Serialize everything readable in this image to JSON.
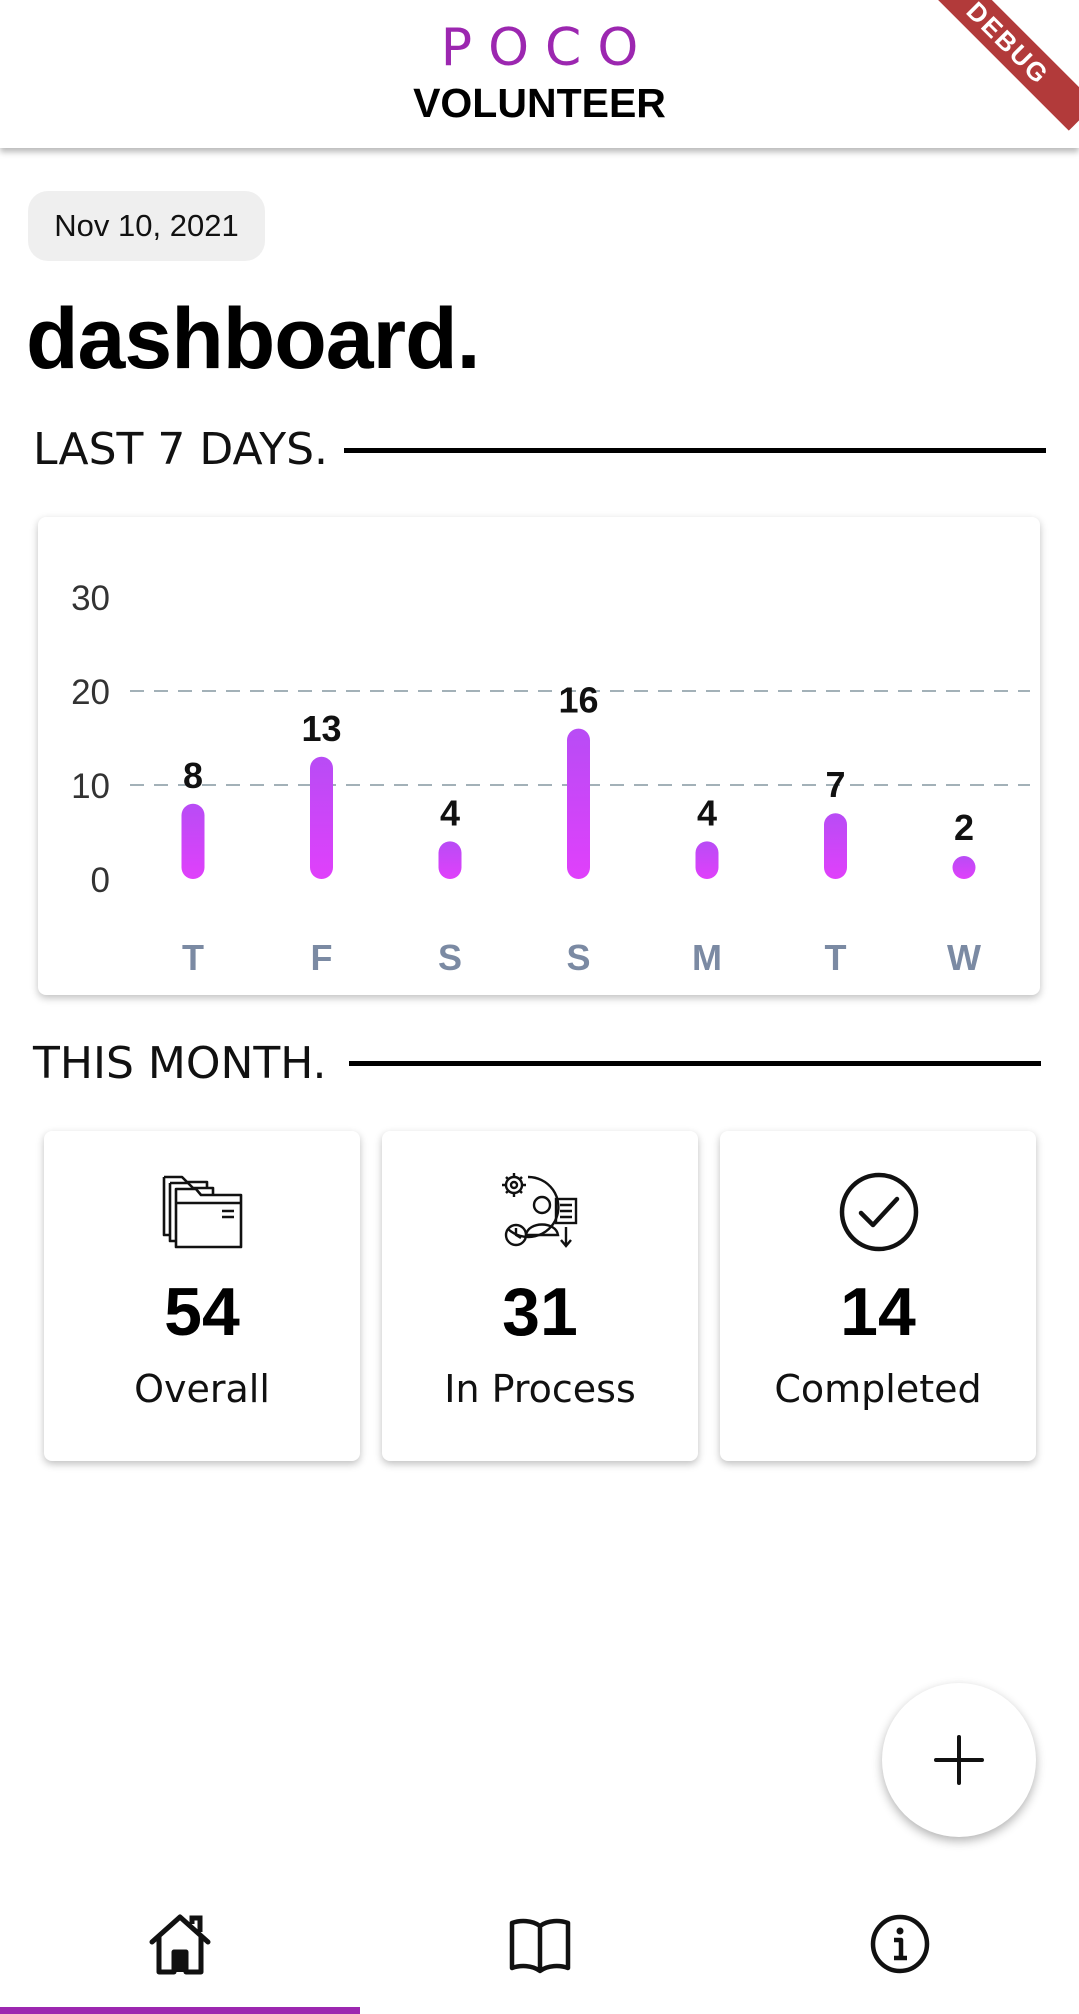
{
  "app": {
    "brand_top": "POCO",
    "brand_bottom": "VOLUNTEER",
    "debug_banner": "DEBUG"
  },
  "header": {
    "date": "Nov 10, 2021",
    "title": "dashboard."
  },
  "sections": {
    "last7": "LAST 7 DAYS.",
    "month": "THIS MONTH."
  },
  "chart_data": {
    "type": "bar",
    "categories": [
      "T",
      "F",
      "S",
      "S",
      "M",
      "T",
      "W"
    ],
    "values": [
      8,
      13,
      4,
      16,
      4,
      7,
      2
    ],
    "yticks": [
      0,
      10,
      20,
      30
    ],
    "ylim": [
      0,
      30
    ],
    "grid": "dashed horizontal at 10 and 20",
    "colors": {
      "bar_top": "#b84cf5",
      "bar_bottom": "#e040fb",
      "tick": "#7b8aa3",
      "grid": "#a3b1b8"
    }
  },
  "stats": [
    {
      "value": "54",
      "label": "Overall",
      "icon": "folders-icon"
    },
    {
      "value": "31",
      "label": "In Process",
      "icon": "process-icon"
    },
    {
      "value": "14",
      "label": "Completed",
      "icon": "check-circle-icon"
    }
  ],
  "fab": {
    "icon": "plus-icon"
  },
  "nav": {
    "items": [
      {
        "icon": "home-icon",
        "active": true
      },
      {
        "icon": "book-icon",
        "active": false
      },
      {
        "icon": "info-icon",
        "active": false
      }
    ],
    "accent": "#9c27b0"
  }
}
